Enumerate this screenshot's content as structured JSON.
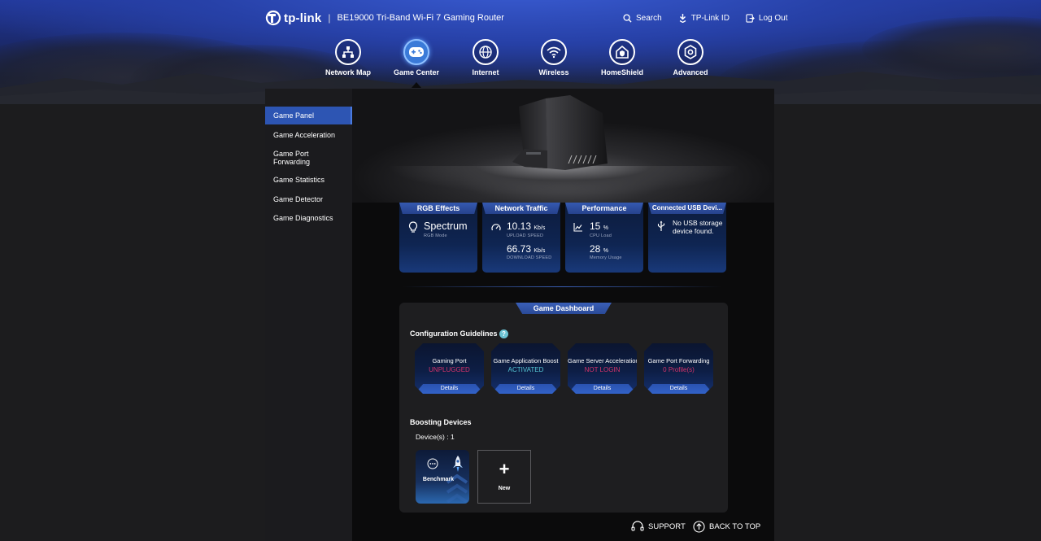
{
  "brand": {
    "logo_text": "tp-link",
    "separator": "|",
    "model": "BE19000 Tri-Band Wi-Fi 7 Gaming Router"
  },
  "top_links": [
    {
      "label": "Search",
      "icon": "search-icon"
    },
    {
      "label": "TP-Link ID",
      "icon": "user-id-icon"
    },
    {
      "label": "Log Out",
      "icon": "logout-icon"
    }
  ],
  "nav": [
    {
      "label": "Network Map",
      "icon": "network-map-icon",
      "active": false
    },
    {
      "label": "Game Center",
      "icon": "gamepad-icon",
      "active": true
    },
    {
      "label": "Internet",
      "icon": "globe-icon",
      "active": false
    },
    {
      "label": "Wireless",
      "icon": "wifi-icon",
      "active": false
    },
    {
      "label": "HomeShield",
      "icon": "home-shield-icon",
      "active": false
    },
    {
      "label": "Advanced",
      "icon": "gear-icon",
      "active": false
    }
  ],
  "sidebar": {
    "items": [
      {
        "label": "Game Panel",
        "active": true
      },
      {
        "label": "Game Acceleration",
        "active": false
      },
      {
        "label": "Game Port Forwarding",
        "active": false
      },
      {
        "label": "Game Statistics",
        "active": false
      },
      {
        "label": "Game Detector",
        "active": false
      },
      {
        "label": "Game Diagnostics",
        "active": false
      }
    ]
  },
  "stats": {
    "rgb": {
      "title": "RGB Effects",
      "value": "Spectrum",
      "caption": "RGB Mode",
      "icon": "lightbulb-icon"
    },
    "traffic": {
      "title": "Network Traffic",
      "upload_value": "10.13",
      "upload_unit": "Kb/s",
      "upload_caption": "UPLOAD SPEED",
      "download_value": "66.73",
      "download_unit": "Kb/s",
      "download_caption": "DOWNLOAD SPEED",
      "icon": "speedometer-icon"
    },
    "performance": {
      "title": "Performance",
      "cpu_value": "15",
      "cpu_unit": "%",
      "cpu_caption": "CPU Load",
      "mem_value": "28",
      "mem_unit": "%",
      "mem_caption": "Memory Usage",
      "icon": "chart-icon"
    },
    "usb": {
      "title": "Connected USB Devi...",
      "message": "No USB storage device found.",
      "icon": "usb-icon"
    }
  },
  "dashboard": {
    "tab_label": "Game Dashboard",
    "guidelines_title": "Configuration Guidelines",
    "help_symbol": "?",
    "guides": [
      {
        "title": "Gaming Port",
        "status": "UNPLUGGED",
        "status_color": "#d6336c",
        "details": "Details"
      },
      {
        "title": "Game Application Boost",
        "status": "ACTIVATED",
        "status_color": "#56c8d8",
        "details": "Details"
      },
      {
        "title": "Game Server Acceleration",
        "status": "NOT LOGIN",
        "status_color": "#d6336c",
        "details": "Details"
      },
      {
        "title": "Game Port Forwarding",
        "status": "0 Profile(s)",
        "status_color": "#d6336c",
        "details": "Details"
      }
    ],
    "boosting_title": "Boosting Devices",
    "device_count": "Device(s) : 1",
    "benchmark_label": "Benchmark",
    "new_plus": "+",
    "new_label": "New"
  },
  "footer": {
    "support": "SUPPORT",
    "back_to_top": "BACK TO TOP"
  },
  "colors": {
    "accent": "#2d55b3",
    "alert": "#d6336c",
    "ok": "#56c8d8"
  }
}
